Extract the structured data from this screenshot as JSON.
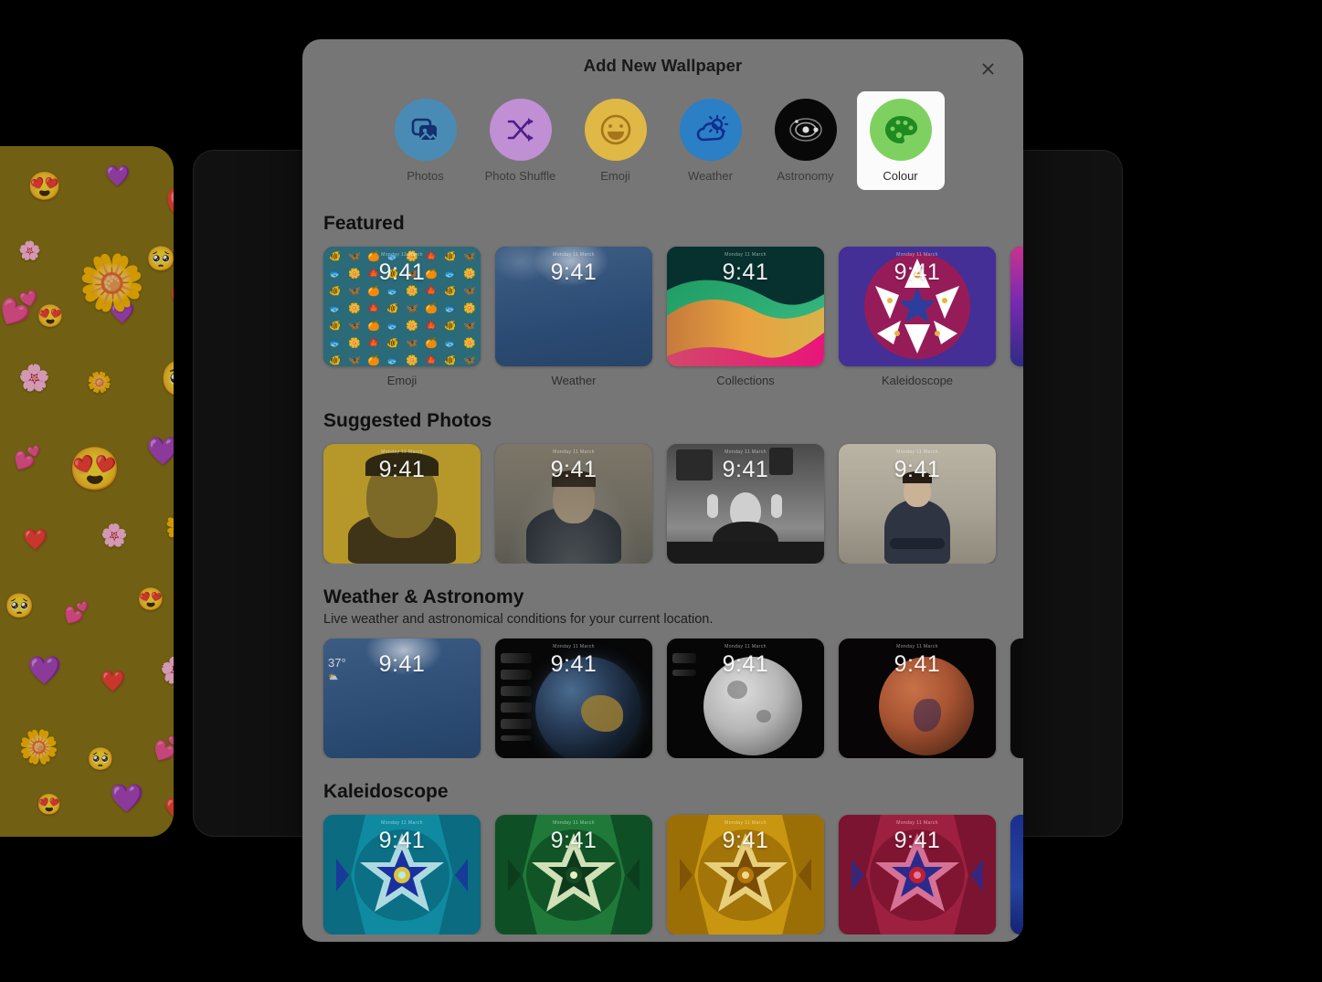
{
  "window": {
    "title": "Add New Wallpaper",
    "close_icon": "close-icon"
  },
  "categories": [
    {
      "id": "photos",
      "label": "Photos",
      "icon": "photos-icon",
      "bg": "#4a8bb5",
      "fg": "#12316e",
      "selected": false
    },
    {
      "id": "photo-shuffle",
      "label": "Photo Shuffle",
      "icon": "shuffle-icon",
      "bg": "#c08fd4",
      "fg": "#4c1f86",
      "selected": false
    },
    {
      "id": "emoji",
      "label": "Emoji",
      "icon": "smiley-icon",
      "bg": "#e0b845",
      "fg": "#a6741b",
      "selected": false
    },
    {
      "id": "weather",
      "label": "Weather",
      "icon": "cloud-sun-icon",
      "bg": "#2b7fc4",
      "fg": "#0f2f8f",
      "selected": false
    },
    {
      "id": "astronomy",
      "label": "Astronomy",
      "icon": "orbit-icon",
      "bg": "#080808",
      "fg": "#dcdcdc",
      "selected": false
    },
    {
      "id": "colour",
      "label": "Colour",
      "icon": "palette-icon",
      "bg": "#7ed160",
      "fg": "#1f8a1f",
      "selected": true
    }
  ],
  "sections": [
    {
      "id": "featured",
      "title": "Featured",
      "subtitle": "",
      "tiles": [
        {
          "label": "Emoji",
          "clock": "9:41",
          "date": "Monday 11 March",
          "style": "emoji-pattern"
        },
        {
          "label": "Weather",
          "clock": "9:41",
          "date": "Monday 11 March",
          "style": "weather-blue"
        },
        {
          "label": "Collections",
          "clock": "9:41",
          "date": "Monday 11 March",
          "style": "collections-wave"
        },
        {
          "label": "Kaleidoscope",
          "clock": "9:41",
          "date": "Monday 11 March",
          "style": "kaleido-orchid"
        },
        {
          "label": "",
          "clock": "",
          "date": "",
          "style": "clip-purple",
          "partial": true
        }
      ]
    },
    {
      "id": "suggested-photos",
      "title": "Suggested Photos",
      "subtitle": "",
      "tiles": [
        {
          "label": "",
          "clock": "9:41",
          "date": "Monday 11 March",
          "style": "photo-yellow"
        },
        {
          "label": "",
          "clock": "9:41",
          "date": "Monday 11 March",
          "style": "photo-grey"
        },
        {
          "label": "",
          "clock": "9:41",
          "date": "Monday 11 March",
          "style": "photo-bw"
        },
        {
          "label": "",
          "clock": "9:41",
          "date": "Monday 11 March",
          "style": "photo-beige"
        }
      ]
    },
    {
      "id": "weather-astronomy",
      "title": "Weather & Astronomy",
      "subtitle": "Live weather and astronomical conditions for your current location.",
      "tiles": [
        {
          "label": "",
          "clock": "9:41",
          "date": "",
          "style": "weather-live",
          "temp": "37°"
        },
        {
          "label": "",
          "clock": "9:41",
          "date": "Monday 11 March",
          "style": "astro-earth"
        },
        {
          "label": "",
          "clock": "9:41",
          "date": "Monday 11 March",
          "style": "astro-moon"
        },
        {
          "label": "",
          "clock": "9:41",
          "date": "Monday 11 March",
          "style": "astro-mars"
        },
        {
          "label": "",
          "clock": "",
          "date": "",
          "style": "clip-black",
          "partial": true
        }
      ]
    },
    {
      "id": "kaleidoscope",
      "title": "Kaleidoscope",
      "subtitle": "",
      "tiles": [
        {
          "label": "",
          "clock": "9:41",
          "date": "Monday 11 March",
          "style": "kal-teal"
        },
        {
          "label": "",
          "clock": "9:41",
          "date": "Monday 11 March",
          "style": "kal-green"
        },
        {
          "label": "",
          "clock": "9:41",
          "date": "Monday 11 March",
          "style": "kal-gold"
        },
        {
          "label": "",
          "clock": "9:41",
          "date": "Monday 11 March",
          "style": "kal-red"
        },
        {
          "label": "",
          "clock": "",
          "date": "",
          "style": "clip-blue",
          "partial": true
        }
      ]
    }
  ],
  "backdrop": {
    "emoji_wallpaper": {
      "background": "#8a7418",
      "glyphs": [
        "😍",
        "💜",
        "❤️",
        "🌸",
        "🌼",
        "🥺",
        "💕"
      ]
    }
  },
  "colors": {
    "modal_bg": "#767676",
    "selected_tile_bg": "#fbfbfb",
    "page_bg": "#000000",
    "back_panel": "#111112"
  }
}
